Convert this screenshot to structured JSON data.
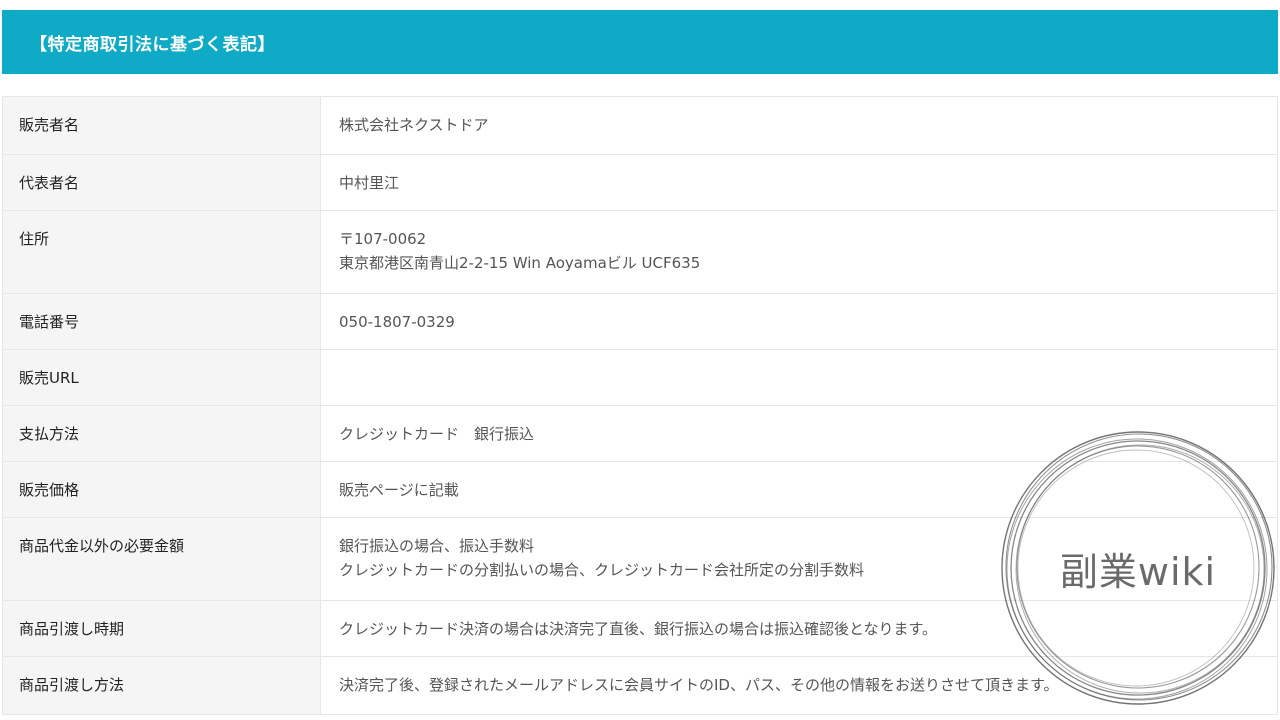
{
  "header": {
    "title": "【特定商取引法に基づく表記】",
    "background_color": "#0eaac6"
  },
  "table": {
    "rows": [
      {
        "label": "販売者名",
        "lines": [
          "株式会社ネクストドア"
        ]
      },
      {
        "label": "代表者名",
        "lines": [
          "中村里江"
        ]
      },
      {
        "label": "住所",
        "lines": [
          "〒107-0062",
          "東京都港区南青山2-2-15 Win Aoyamaビル UCF635"
        ]
      },
      {
        "label": "電話番号",
        "lines": [
          "050-1807-0329"
        ]
      },
      {
        "label": "販売URL",
        "lines": [
          ""
        ]
      },
      {
        "label": "支払方法",
        "lines": [
          "クレジットカード　銀行振込"
        ]
      },
      {
        "label": "販売価格",
        "lines": [
          "販売ページに記載"
        ]
      },
      {
        "label": "商品代金以外の必要金額",
        "lines": [
          "銀行振込の場合、振込手数料",
          "クレジットカードの分割払いの場合、クレジットカード会社所定の分割手数料"
        ]
      },
      {
        "label": "商品引渡し時期",
        "lines": [
          "クレジットカード決済の場合は決済完了直後、銀行振込の場合は振込確認後となります。"
        ]
      },
      {
        "label": "商品引渡し方法",
        "lines": [
          "決済完了後、登録されたメールアドレスに会員サイトのID、パス、その他の情報をお送りさせて頂きます。"
        ]
      }
    ]
  },
  "watermark": {
    "text": "副業wiki"
  }
}
